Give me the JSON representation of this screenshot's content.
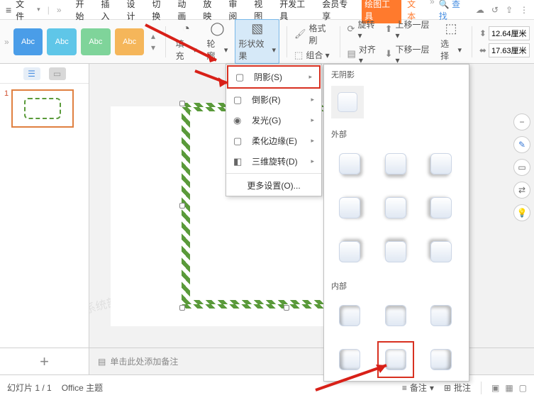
{
  "titlebar": {
    "file_label": "文件",
    "tabs": [
      "开始",
      "插入",
      "设计",
      "切换",
      "动画",
      "放映",
      "审阅",
      "视图",
      "开发工具",
      "会员专享",
      "绘图工具",
      "文本"
    ],
    "active_tool_idx": 10,
    "text_tool_idx": 11,
    "search_label": "查找"
  },
  "ribbon": {
    "chip_text": "Abc",
    "fill": "填充",
    "outline": "轮廓",
    "shape_effect": "形状效果",
    "format_brush": "格式刷",
    "combine": "组合",
    "rotate": "旋转",
    "align": "对齐",
    "bring_forward": "上移一层",
    "send_backward": "下移一层",
    "select": "选择",
    "height_value": "12.64厘米",
    "width_value": "17.63厘米"
  },
  "effect_menu": {
    "items": [
      {
        "label": "阴影(S)",
        "icon": "▢"
      },
      {
        "label": "倒影(R)",
        "icon": "▢"
      },
      {
        "label": "发光(G)",
        "icon": "◉"
      },
      {
        "label": "柔化边缘(E)",
        "icon": "▢"
      },
      {
        "label": "三维旋转(D)",
        "icon": "◧"
      }
    ],
    "more_settings": "更多设置(O)..."
  },
  "shadow_panel": {
    "no_shadow": "无阴影",
    "outer": "外部",
    "inner": "内部",
    "tooltip": "内部"
  },
  "thumbnails": {
    "slide_num": "1"
  },
  "notes": {
    "placeholder": "单击此处添加备注"
  },
  "status": {
    "slide_counter": "幻灯片 1 / 1",
    "theme": "Office 主题",
    "notes_label": "备注",
    "comments_label": "批注"
  },
  "watermark": "系统部落xitongbuluo.com"
}
